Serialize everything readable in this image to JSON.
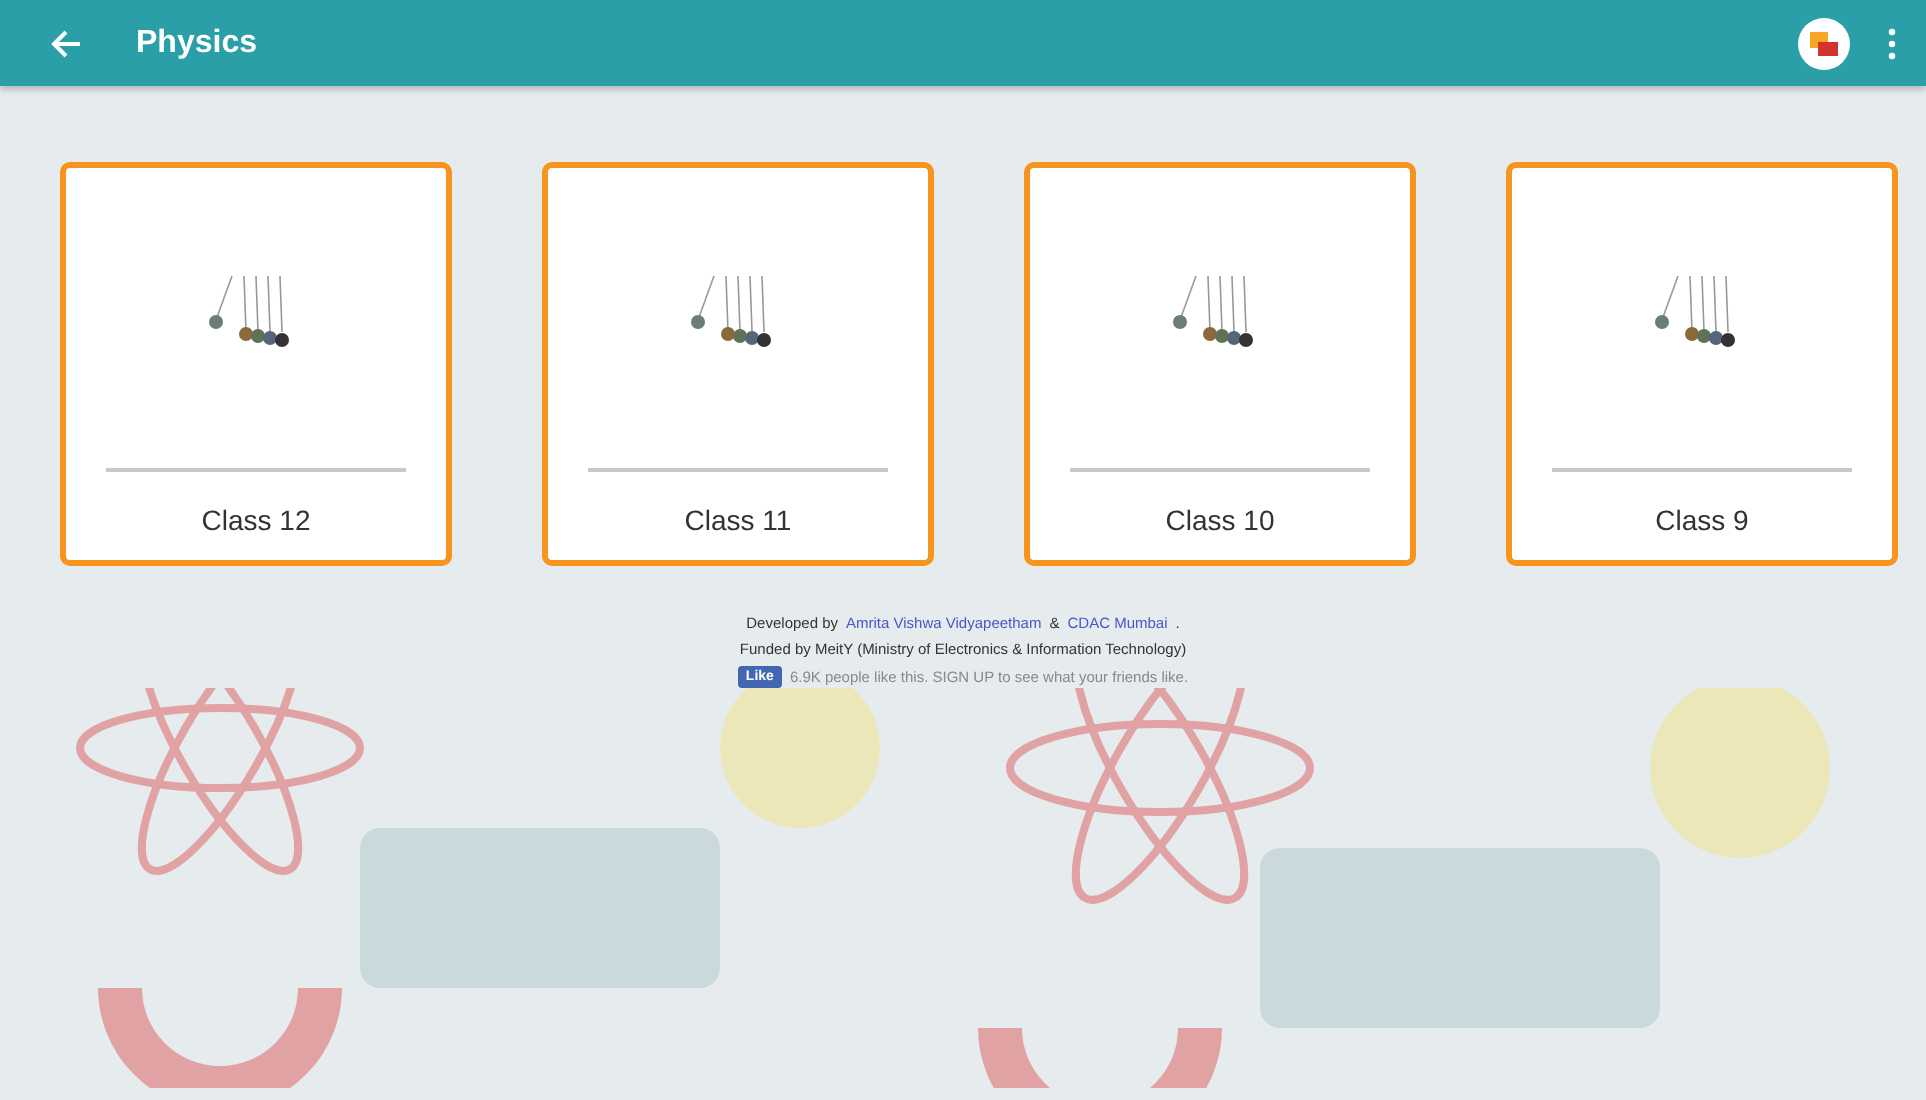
{
  "app_bar": {
    "title": "Physics"
  },
  "cards": [
    {
      "label": "Class 12"
    },
    {
      "label": "Class 11"
    },
    {
      "label": "Class 10"
    },
    {
      "label": "Class 9"
    }
  ],
  "footer": {
    "developed_by": "Developed by",
    "dev1": "Amrita Vishwa Vidyapeetham",
    "amp": "&",
    "dev2": "CDAC Mumbai",
    "dot": ".",
    "funded": "Funded by MeitY (Ministry of Electronics & Information Technology)",
    "like_button": "Like",
    "like_text": "6.9K people like this. SIGN UP to see what your friends like."
  }
}
